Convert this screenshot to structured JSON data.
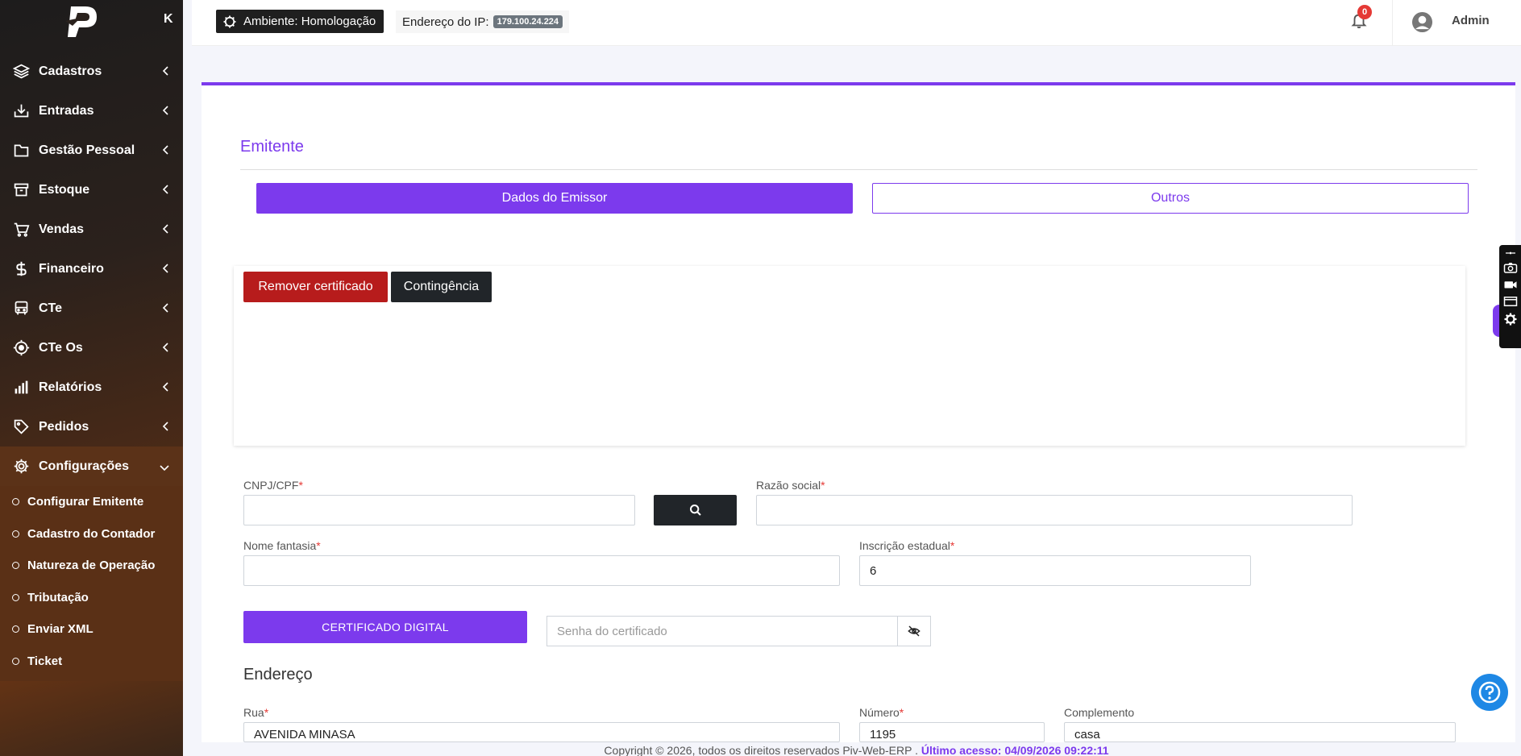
{
  "sidebar": {
    "collapse_label": "K",
    "items": [
      {
        "label": "Cadastros",
        "icon": "layers-icon"
      },
      {
        "label": "Entradas",
        "icon": "inbox-download-icon"
      },
      {
        "label": "Gestão Pessoal",
        "icon": "folder-icon"
      },
      {
        "label": "Estoque",
        "icon": "archive-icon"
      },
      {
        "label": "Vendas",
        "icon": "cart-icon"
      },
      {
        "label": "Financeiro",
        "icon": "dollar-icon"
      },
      {
        "label": "CTe",
        "icon": "bus-icon"
      },
      {
        "label": "CTe Os",
        "icon": "target-icon"
      },
      {
        "label": "Relatórios",
        "icon": "bar-chart-icon"
      },
      {
        "label": "Pedidos",
        "icon": "tag-icon"
      },
      {
        "label": "Configurações",
        "icon": "gear-icon"
      }
    ],
    "subitems": [
      "Configurar Emitente",
      "Cadastro do Contador",
      "Natureza de Operação",
      "Tributação",
      "Enviar XML",
      "Ticket"
    ]
  },
  "topbar": {
    "env_label": "Ambiente: Homologação",
    "ip_label": "Endereço do IP:",
    "ip_value": "179.100.24.224",
    "notification_count": "0",
    "user_name": "Admin"
  },
  "main": {
    "section_title": "Emitente",
    "tabs": [
      "Dados do Emissor",
      "Outros"
    ],
    "remove_cert_label": "Remover certificado",
    "contingency_label": "Contingência",
    "fields": {
      "cnpj_label": "CNPJ/CPF",
      "cnpj_value": "",
      "razao_label": "Razão social",
      "razao_value": "",
      "fantasia_label": "Nome fantasia",
      "fantasia_value": "",
      "ie_label": "Inscrição estadual",
      "ie_value": "6"
    },
    "cert_button_label": "CERTIFICADO DIGITAL",
    "password_placeholder": "Senha do certificado",
    "address_title": "Endereço",
    "address": {
      "rua_label": "Rua",
      "rua_value": "AVENIDA MINASA",
      "numero_label": "Número",
      "numero_value": "1195",
      "complemento_label": "Complemento",
      "complemento_value": "casa"
    },
    "required_mark": "*"
  },
  "footer": {
    "text": "Copyright © 2026, todos os direitos reservados Piv-Web-ERP .",
    "last_access": "Último acesso: 04/09/2026 09:22:11"
  },
  "colors": {
    "accent": "#7c3aed",
    "danger": "#b71c1c",
    "dark": "#212529"
  }
}
